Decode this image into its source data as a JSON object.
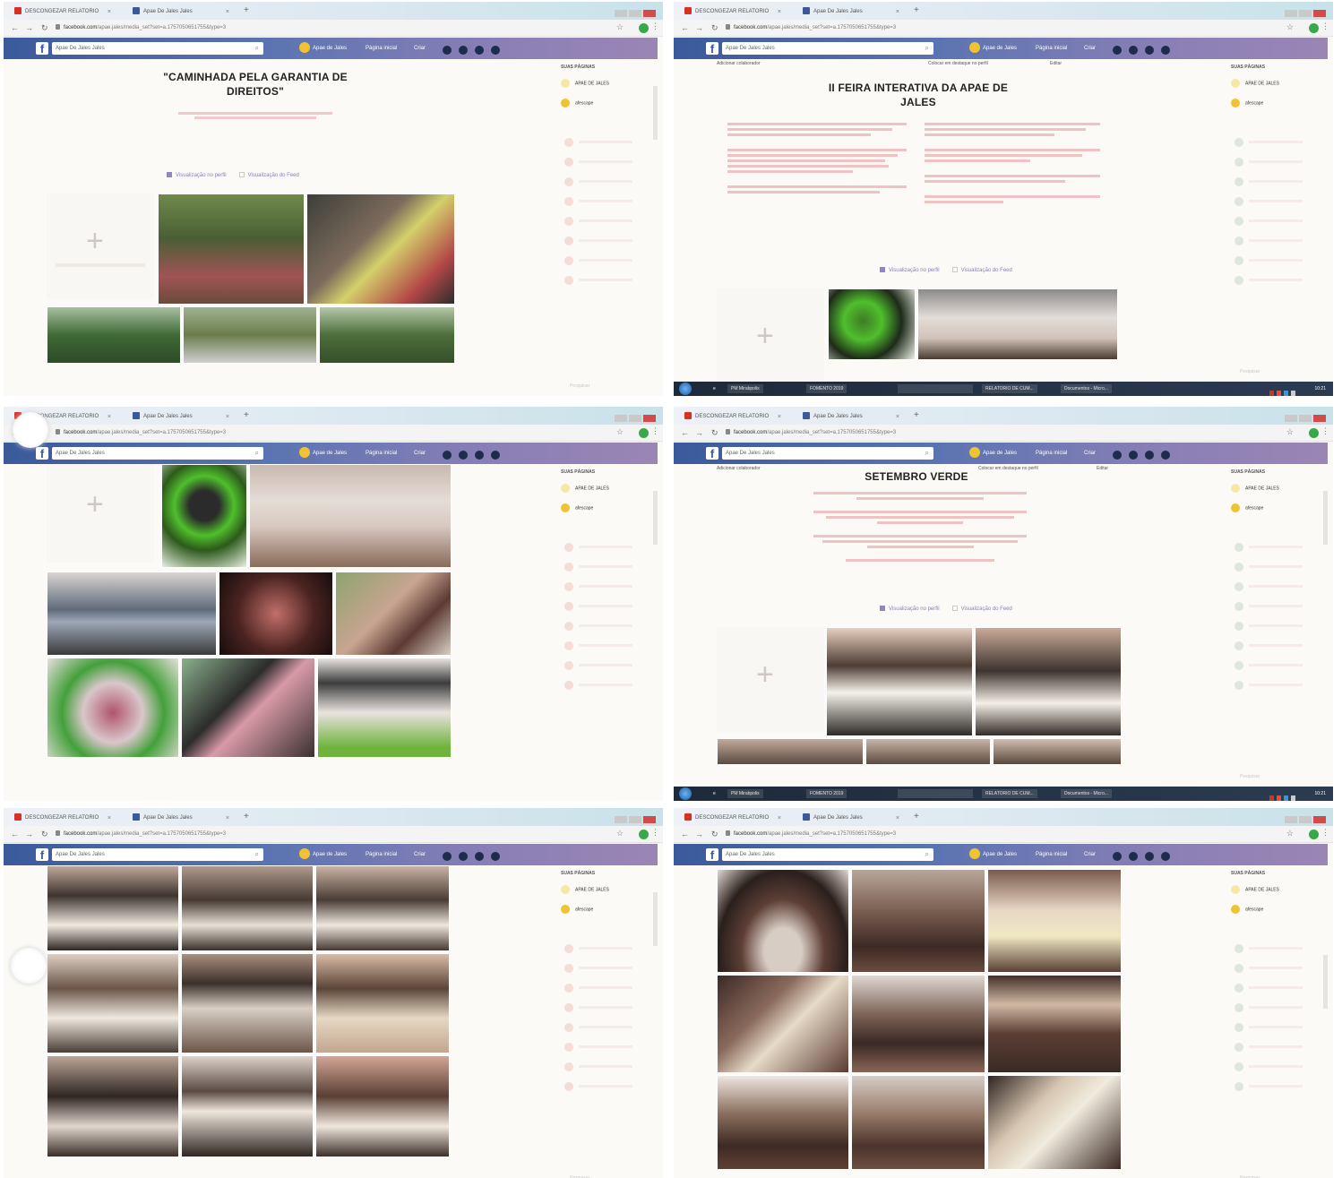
{
  "browser": {
    "tab1_label": "DESCONGEZAR RELATORIO",
    "tab2_label": "Apae De Jales Jales",
    "url_host": "facebook.com",
    "url_path": "/apae.jales/media_set?set=a.1757050651755&type=3"
  },
  "facebook": {
    "search_value": "Apae De Jales Jales",
    "user_name": "Apae de Jales",
    "home_link": "Página inicial",
    "create_link": "Criar",
    "add_collaborator": "Adicionar colaborador",
    "feature_on_profile": "Colocar em destaque no perfil",
    "edit": "Editar",
    "view_profile": "Visualização no perfil",
    "view_feed": "Visualização do Feed"
  },
  "sidebar": {
    "heading": "SUAS PÁGINAS",
    "page1": "APAE DE JALES",
    "page2": "afescape",
    "search": "Pesquisar"
  },
  "posts": {
    "title1": "\"CAMINHADA PELA GARANTIA DE DIREITOS\"",
    "title2": "II FEIRA INTERATIVA DA APAE DE JALES",
    "title4": "SETEMBRO VERDE"
  },
  "taskbar": {
    "item1": "PM Mirabpolis",
    "item2": "FOMENTO 2019",
    "item3": "RELATORIO DE CUM...",
    "item4": "Documentos - Micro...",
    "clock": "10:21"
  },
  "colors": {
    "fb_blue": "#3b5998",
    "fb_bar_end": "#9a86b5",
    "accent_green": "#39a84b",
    "body_text_red": "#d36b6b"
  }
}
